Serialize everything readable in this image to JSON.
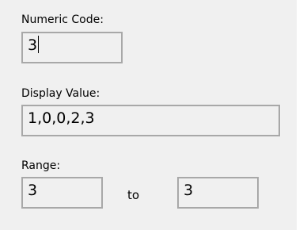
{
  "numeric_code": {
    "label": "Numeric Code:",
    "value": "3"
  },
  "display_value": {
    "label": "Display Value:",
    "value": "1,0,0,2,3"
  },
  "range": {
    "label": "Range:",
    "from_value": "3",
    "to_label": "to",
    "to_value": "3"
  }
}
